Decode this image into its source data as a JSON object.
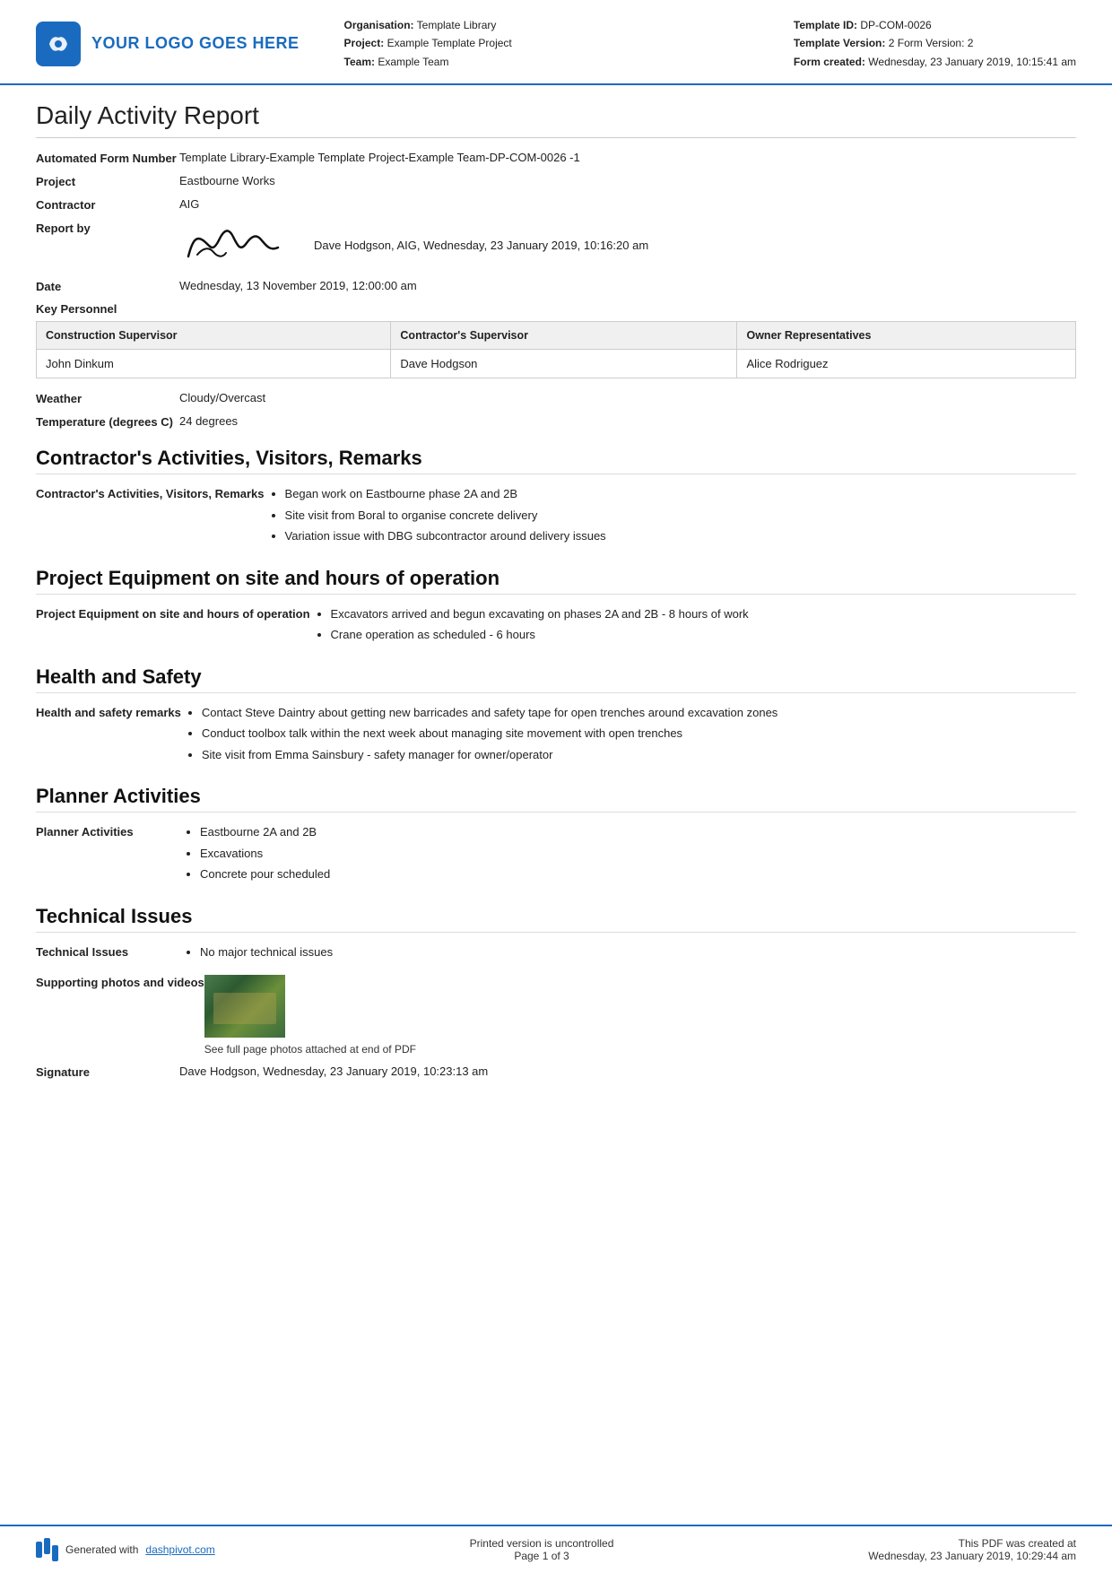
{
  "header": {
    "logo_text": "YOUR LOGO GOES HERE",
    "org_label": "Organisation:",
    "org_value": "Template Library",
    "project_label": "Project:",
    "project_value": "Example Template Project",
    "team_label": "Team:",
    "team_value": "Example Team",
    "template_id_label": "Template ID:",
    "template_id_value": "DP-COM-0026",
    "template_version_label": "Template Version:",
    "template_version_value": "2 Form Version: 2",
    "form_created_label": "Form created:",
    "form_created_value": "Wednesday, 23 January 2019, 10:15:41 am"
  },
  "report": {
    "title": "Daily Activity Report",
    "form_number_label": "Automated Form Number",
    "form_number_value": "Template Library-Example Template Project-Example Team-DP-COM-0026   -1",
    "project_label": "Project",
    "project_value": "Eastbourne Works",
    "contractor_label": "Contractor",
    "contractor_value": "AIG",
    "report_by_label": "Report by",
    "report_by_value": "Dave Hodgson, AIG, Wednesday, 23 January 2019, 10:16:20 am",
    "date_label": "Date",
    "date_value": "Wednesday, 13 November 2019, 12:00:00 am",
    "key_personnel_label": "Key Personnel",
    "personnel_col1": "Construction Supervisor",
    "personnel_col2": "Contractor's Supervisor",
    "personnel_col3": "Owner Representatives",
    "personnel_row1_col1": "John Dinkum",
    "personnel_row1_col2": "Dave Hodgson",
    "personnel_row1_col3": "Alice Rodriguez",
    "weather_label": "Weather",
    "weather_value": "Cloudy/Overcast",
    "temperature_label": "Temperature (degrees C)",
    "temperature_value": "24 degrees"
  },
  "sections": {
    "contractors": {
      "heading": "Contractor's Activities, Visitors, Remarks",
      "label": "Contractor's Activities, Visitors, Remarks",
      "items": [
        "Began work on Eastbourne phase 2A and 2B",
        "Site visit from Boral to organise concrete delivery",
        "Variation issue with DBG subcontractor around delivery issues"
      ]
    },
    "equipment": {
      "heading": "Project Equipment on site and hours of operation",
      "label": "Project Equipment on site and hours of operation",
      "items": [
        "Excavators arrived and begun excavating on phases 2A and 2B - 8 hours of work",
        "Crane operation as scheduled - 6 hours"
      ]
    },
    "health_safety": {
      "heading": "Health and Safety",
      "label": "Health and safety remarks",
      "items": [
        "Contact Steve Daintry about getting new barricades and safety tape for open trenches around excavation zones",
        "Conduct toolbox talk within the next week about managing site movement with open trenches",
        "Site visit from Emma Sainsbury - safety manager for owner/operator"
      ]
    },
    "planner": {
      "heading": "Planner Activities",
      "label": "Planner Activities",
      "items": [
        "Eastbourne 2A and 2B",
        "Excavations",
        "Concrete pour scheduled"
      ]
    },
    "technical": {
      "heading": "Technical Issues",
      "label": "Technical Issues",
      "items": [
        "No major technical issues"
      ],
      "photos_label": "Supporting photos and videos",
      "photo_caption": "See full page photos attached at end of PDF",
      "signature_label": "Signature",
      "signature_value": "Dave Hodgson, Wednesday, 23 January 2019, 10:23:13 am"
    }
  },
  "footer": {
    "generated_text": "Generated with",
    "link_text": "dashpivot.com",
    "center_line1": "Printed version is uncontrolled",
    "center_line2": "Page 1 of 3",
    "right_line1": "This PDF was created at",
    "right_line2": "Wednesday, 23 January 2019, 10:29:44 am"
  }
}
